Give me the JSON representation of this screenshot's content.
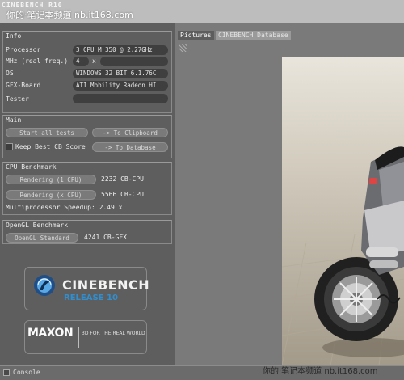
{
  "window": {
    "title": "CINEBENCH R10",
    "watermark": "你的·笔记本频道 nb.it168.com"
  },
  "info": {
    "title": "Info",
    "processor_label": "Processor",
    "processor_value": "3 CPU M 350 @ 2.27GHz",
    "mhz_label": "MHz (real freq.)",
    "mhz_value": "4",
    "mhz_x": "x",
    "os_label": "OS",
    "os_value": "WINDOWS 32 BIT 6.1.76C",
    "gfx_label": "GFX-Board",
    "gfx_value": "ATI Mobility Radeon HI",
    "tester_label": "Tester",
    "tester_value": ""
  },
  "main": {
    "title": "Main",
    "start_all": "Start all tests",
    "to_clipboard": "-> To Clipboard",
    "keep_best": "Keep Best CB Score",
    "to_database": "-> To Database"
  },
  "cpu": {
    "title": "CPU Benchmark",
    "render_1": "Rendering (1 CPU)",
    "score_1": "2232 CB-CPU",
    "render_x": "Rendering (x CPU)",
    "score_x": "5566 CB-CPU",
    "speedup": "Multiprocessor Speedup: 2.49 x"
  },
  "opengl": {
    "title": "OpenGL Benchmark",
    "button": "OpenGL Standard",
    "score": "4241 CB-GFX"
  },
  "logo": {
    "name": "CINEBENCH",
    "release": "RELEASE 10",
    "maxon": "MAXON",
    "tagline": "3D FOR THE REAL WORLD"
  },
  "console": {
    "label": "Console"
  },
  "tabs": {
    "pictures": "Pictures",
    "database": "CINEBENCH Database"
  },
  "footer_watermark": "你的·笔记本频道 nb.it168.com",
  "colors": {
    "accent_blue": "#2f8fd0",
    "panel": "#5e5e5e",
    "field": "#3f3f3f"
  }
}
